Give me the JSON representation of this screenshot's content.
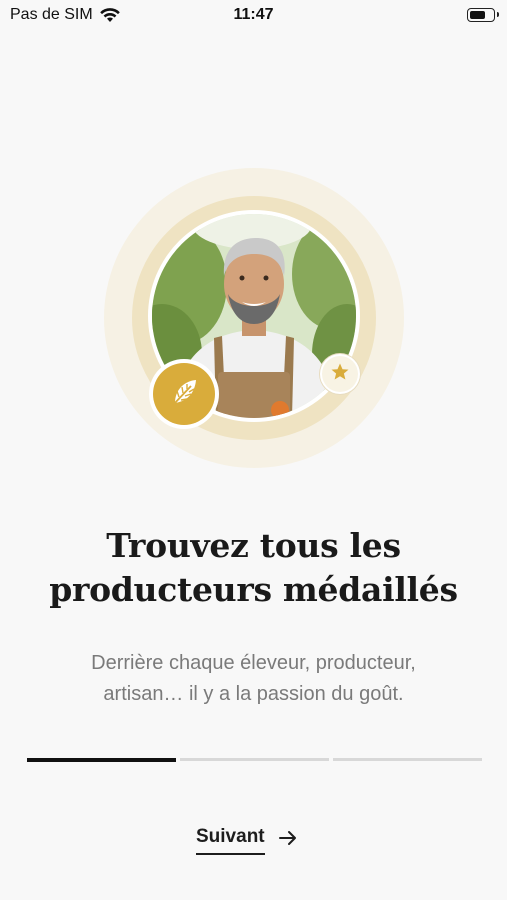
{
  "status_bar": {
    "carrier": "Pas de SIM",
    "time": "11:47",
    "battery_level": 0.75,
    "icons": [
      "wifi-icon",
      "battery-icon"
    ]
  },
  "hero": {
    "icons": [
      "leaf-icon",
      "star-icon"
    ],
    "colors": {
      "halo_outer": "#f6f1e4",
      "halo_inner": "#efe3c2",
      "badge": "#d9ac3b"
    }
  },
  "onboarding": {
    "title_line1": "Trouvez tous les",
    "title_line2": "producteurs médaillés",
    "subtitle_line1": "Derrière chaque éleveur, producteur,",
    "subtitle_line2": "artisan… il y a la passion du goût.",
    "steps_total": 3,
    "current_step": 1
  },
  "actions": {
    "next_label": "Suivant",
    "next_icon": "arrow-right-icon"
  }
}
